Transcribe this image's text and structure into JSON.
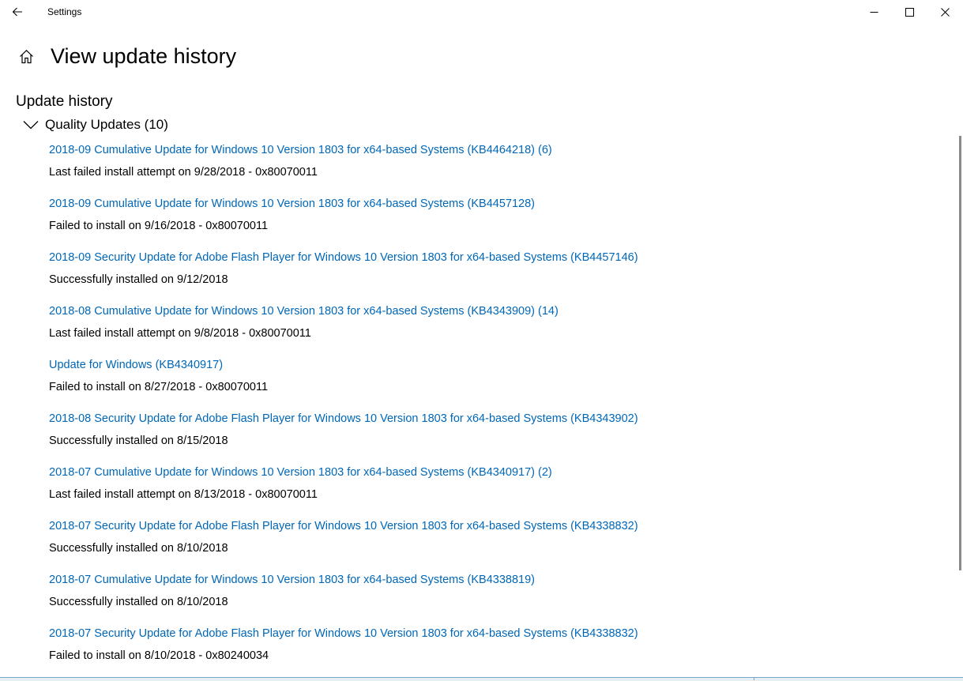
{
  "window": {
    "title": "Settings",
    "back_icon": "back-arrow-icon",
    "minimize_icon": "minimize-icon",
    "maximize_icon": "maximize-icon",
    "close_icon": "close-icon"
  },
  "header": {
    "home_icon": "home-icon",
    "title": "View update history"
  },
  "section": {
    "title": "Update history"
  },
  "group": {
    "label": "Quality Updates (10)",
    "expanded": true,
    "chevron_icon": "chevron-down-icon"
  },
  "updates": [
    {
      "name": "2018-09 Cumulative Update for Windows 10 Version 1803 for x64-based Systems (KB4464218) (6)",
      "status": "Last failed install attempt on 9/28/2018 - 0x80070011"
    },
    {
      "name": "2018-09 Cumulative Update for Windows 10 Version 1803 for x64-based Systems (KB4457128)",
      "status": "Failed to install on 9/16/2018 - 0x80070011"
    },
    {
      "name": "2018-09 Security Update for Adobe Flash Player for Windows 10 Version 1803 for x64-based Systems (KB4457146)",
      "status": "Successfully installed on 9/12/2018"
    },
    {
      "name": "2018-08 Cumulative Update for Windows 10 Version 1803 for x64-based Systems (KB4343909) (14)",
      "status": "Last failed install attempt on 9/8/2018 - 0x80070011"
    },
    {
      "name": "Update for Windows (KB4340917)",
      "status": "Failed to install on 8/27/2018 - 0x80070011"
    },
    {
      "name": "2018-08 Security Update for Adobe Flash Player for Windows 10 Version 1803 for x64-based Systems (KB4343902)",
      "status": "Successfully installed on 8/15/2018"
    },
    {
      "name": "2018-07 Cumulative Update for Windows 10 Version 1803 for x64-based Systems (KB4340917) (2)",
      "status": "Last failed install attempt on 8/13/2018 - 0x80070011"
    },
    {
      "name": "2018-07 Security Update for Adobe Flash Player for Windows 10 Version 1803 for x64-based Systems (KB4338832)",
      "status": "Successfully installed on 8/10/2018"
    },
    {
      "name": "2018-07 Cumulative Update for Windows 10 Version 1803 for x64-based Systems (KB4338819)",
      "status": "Successfully installed on 8/10/2018"
    },
    {
      "name": "2018-07 Security Update for Adobe Flash Player for Windows 10 Version 1803 for x64-based Systems (KB4338832)",
      "status": "Failed to install on 8/10/2018 - 0x80240034"
    }
  ],
  "colors": {
    "link": "#0067b8",
    "text": "#000000",
    "background": "#ffffff",
    "scrollbar": "#8a8a8a"
  }
}
